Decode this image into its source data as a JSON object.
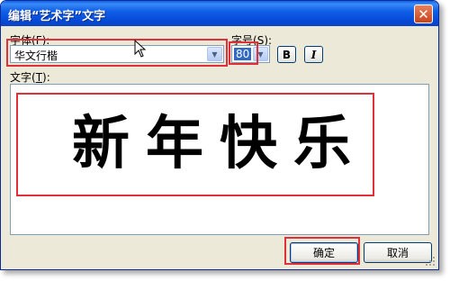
{
  "dialog": {
    "title": "编辑“艺术字”文字",
    "close_glyph": "✕"
  },
  "font": {
    "label_text": "字体",
    "label_key": "F",
    "value": "华文行楷"
  },
  "size": {
    "label_text": "字号",
    "label_key": "S",
    "value": "80"
  },
  "style_buttons": {
    "bold": "B",
    "italic": "I"
  },
  "text": {
    "label_text": "文字",
    "label_key": "T",
    "value": "新年快乐"
  },
  "buttons": {
    "ok": "确定",
    "cancel": "取消"
  },
  "colors": {
    "titlebar": "#0549d6",
    "dialog_bg": "#ece9d8",
    "highlight": "#e0303a",
    "selection": "#316ac5"
  }
}
